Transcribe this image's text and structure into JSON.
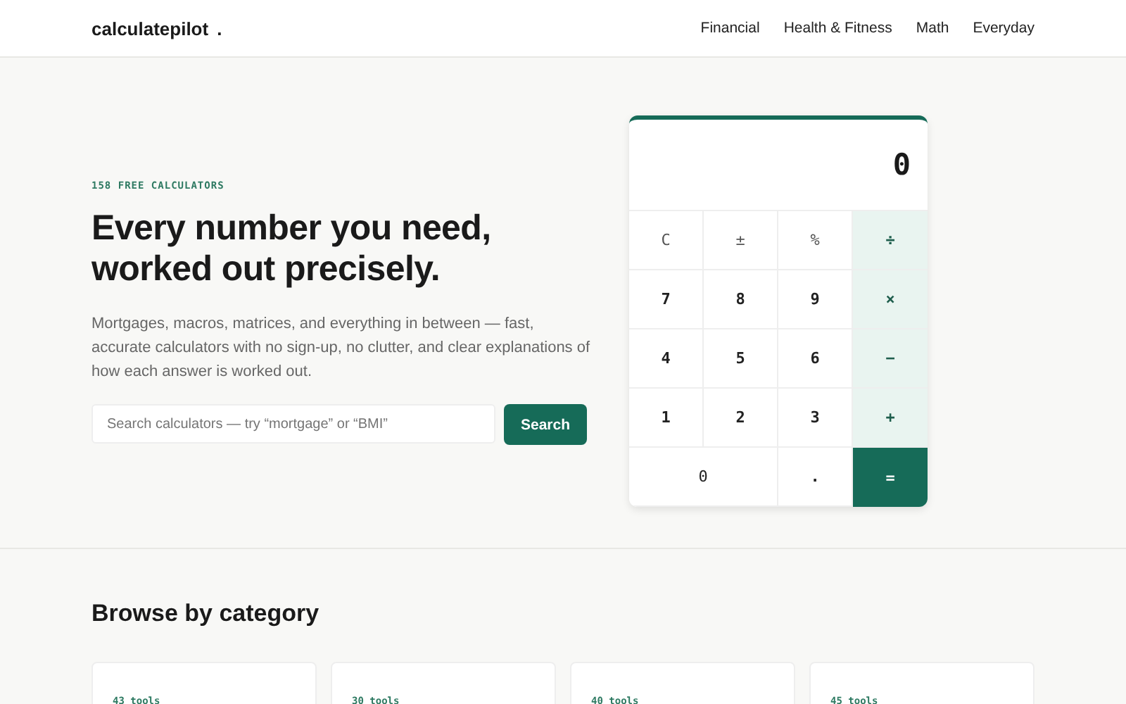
{
  "header": {
    "logo": "calculatepilot",
    "logo_mark": ".",
    "nav": [
      "Financial",
      "Health & Fitness",
      "Math",
      "Everyday"
    ]
  },
  "hero": {
    "eyebrow": "158 FREE CALCULATORS",
    "title_lines": [
      "Every number you need,",
      "worked out precisely."
    ],
    "lead": "Mortgages, macros, matrices, and everything in between — fast, accurate calculators with no sign-up, no clutter, and clear explanations of how each answer is worked out.",
    "search": {
      "placeholder": "Search calculators — try “mortgage” or “BMI”"
    },
    "search_button": "Search"
  },
  "calculator": {
    "display": "0",
    "keys": [
      {
        "label": "C",
        "kind": "func"
      },
      {
        "label": "±",
        "kind": "func"
      },
      {
        "label": "%",
        "kind": "func"
      },
      {
        "label": "÷",
        "kind": "op"
      },
      {
        "label": "7",
        "kind": "digit"
      },
      {
        "label": "8",
        "kind": "digit"
      },
      {
        "label": "9",
        "kind": "digit"
      },
      {
        "label": "×",
        "kind": "op"
      },
      {
        "label": "4",
        "kind": "digit"
      },
      {
        "label": "5",
        "kind": "digit"
      },
      {
        "label": "6",
        "kind": "digit"
      },
      {
        "label": "−",
        "kind": "op"
      },
      {
        "label": "1",
        "kind": "digit"
      },
      {
        "label": "2",
        "kind": "digit"
      },
      {
        "label": "3",
        "kind": "digit"
      },
      {
        "label": "+",
        "kind": "op"
      },
      {
        "label": "0",
        "kind": "wide"
      },
      {
        "label": ".",
        "kind": "digit"
      },
      {
        "label": "=",
        "kind": "equals"
      }
    ]
  },
  "categories": {
    "title": "Browse by category",
    "cards": [
      {
        "count": "43 tools"
      },
      {
        "count": "30 tools"
      },
      {
        "count": "40 tools"
      },
      {
        "count": "45 tools"
      }
    ]
  }
}
